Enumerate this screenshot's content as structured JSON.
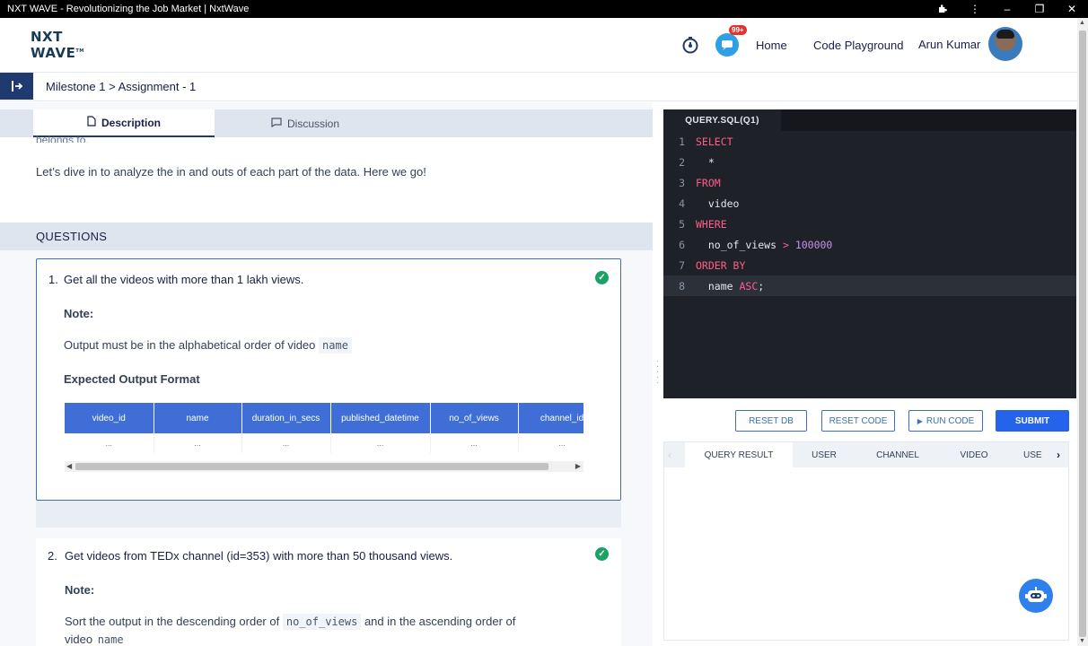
{
  "window": {
    "title": "NXT WAVE - Revolutionizing the Job Market | NxtWave"
  },
  "header": {
    "logo_line1": "NXT",
    "logo_line2": "WAVE",
    "logo_tm": "TM",
    "notif_count": "99+",
    "nav_home": "Home",
    "nav_playground": "Code Playground",
    "user_name": "Arun Kumar"
  },
  "breadcrumb": "Milestone 1 > Assignment - 1",
  "tabs": {
    "description": "Description",
    "discussion": "Discussion"
  },
  "intro": {
    "cut_text": "belongs to.",
    "text": "Let’s dive in to analyze the in and outs of each part of the data. Here we go!"
  },
  "questions_heading": "QUESTIONS",
  "q1": {
    "number": "1.",
    "text": "Get all the videos with more than 1 lakh views.",
    "note_label": "Note:",
    "note_text": "Output must be in the alphabetical order of video",
    "note_code": "name",
    "expected_label": "Expected Output Format",
    "columns": [
      "video_id",
      "name",
      "duration_in_secs",
      "published_datetime",
      "no_of_views",
      "channel_id"
    ],
    "placeholder": "..."
  },
  "q2": {
    "number": "2.",
    "text": "Get videos from TEDx channel (id=353) with more than 50 thousand views.",
    "note_label": "Note:",
    "note_text_a": "Sort the output in the descending order of",
    "note_code_a": "no_of_views",
    "note_text_b": "and in the ascending order of",
    "note_text_c": "video",
    "note_code_b": "name"
  },
  "editor": {
    "tab": "QUERY.SQL(Q1)",
    "lines": [
      "SELECT",
      "  *",
      "FROM",
      "  video",
      "WHERE",
      "  no_of_views > 100000",
      "ORDER BY",
      "  name ASC;"
    ],
    "current_line": 8
  },
  "actions": {
    "reset_db": "RESET DB",
    "reset_code": "RESET CODE",
    "run_code": "RUN CODE",
    "submit": "SUBMIT"
  },
  "result_tabs": [
    "QUERY RESULT",
    "USER",
    "CHANNEL",
    "VIDEO",
    "USE"
  ],
  "colors": {
    "accent": "#2563eb",
    "success": "#1aa365",
    "editor_bg": "#1e2128"
  }
}
